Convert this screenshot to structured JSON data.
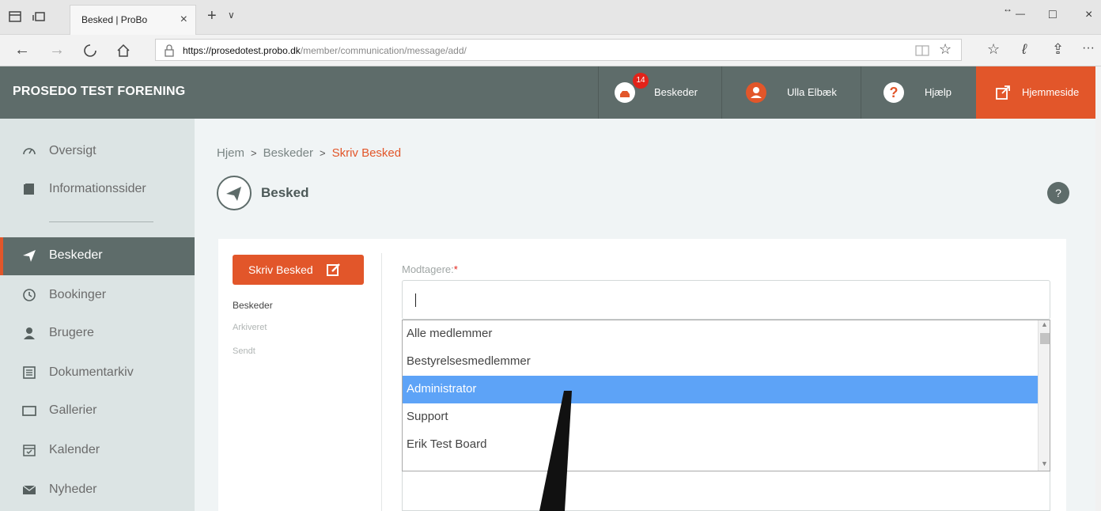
{
  "browser": {
    "tab_title": "Besked | ProBo",
    "tab_close": "×",
    "new_tab": "+",
    "tab_menu": "∨",
    "url_host": "https://prosedotest.probo.dk",
    "url_path": "/member/communication/message/add/",
    "window_controls": {
      "minimize": "—",
      "maximize": "□",
      "close": "×",
      "restore": "↔"
    },
    "more": "···"
  },
  "header": {
    "brand": "PROSEDO TEST FORENING",
    "messages": {
      "label": "Beskeder",
      "badge": "14"
    },
    "user": {
      "label": "Ulla Elbæk"
    },
    "help": {
      "label": "Hjælp",
      "glyph": "?"
    },
    "website": {
      "label": "Hjemmeside"
    }
  },
  "sidebar": {
    "items": [
      {
        "label": "Oversigt",
        "icon": "gauge-icon"
      },
      {
        "label": "Informationssider",
        "icon": "book-icon"
      },
      {
        "label": "Beskeder",
        "icon": "paper-plane-icon",
        "active": true
      },
      {
        "label": "Bookinger",
        "icon": "clock-icon"
      },
      {
        "label": "Brugere",
        "icon": "user-icon"
      },
      {
        "label": "Dokumentarkiv",
        "icon": "archive-icon"
      },
      {
        "label": "Gallerier",
        "icon": "gallery-icon"
      },
      {
        "label": "Kalender",
        "icon": "calendar-icon"
      },
      {
        "label": "Nyheder",
        "icon": "envelope-icon"
      }
    ]
  },
  "main": {
    "breadcrumb": {
      "home": "Hjem",
      "section": "Beskeder",
      "current": "Skriv Besked",
      "sep": ">"
    },
    "page_title": "Besked",
    "help_glyph": "?",
    "compose_button": "Skriv Besked",
    "sub_links": [
      "Beskeder",
      "Arkiveret",
      "Sendt"
    ],
    "recipients_label": "Modtagere:",
    "required_mark": "*",
    "dropdown_options": [
      "Alle medlemmer",
      "Bestyrelsesmedlemmer",
      "Administrator",
      "Support",
      "Erik Test Board"
    ],
    "selected_option": "Administrator"
  },
  "colors": {
    "header_bg": "#5e6c6a",
    "accent": "#e2562a",
    "badge": "#e2231a",
    "sidebar_bg": "#dce4e4",
    "selection": "#5da3f7"
  }
}
